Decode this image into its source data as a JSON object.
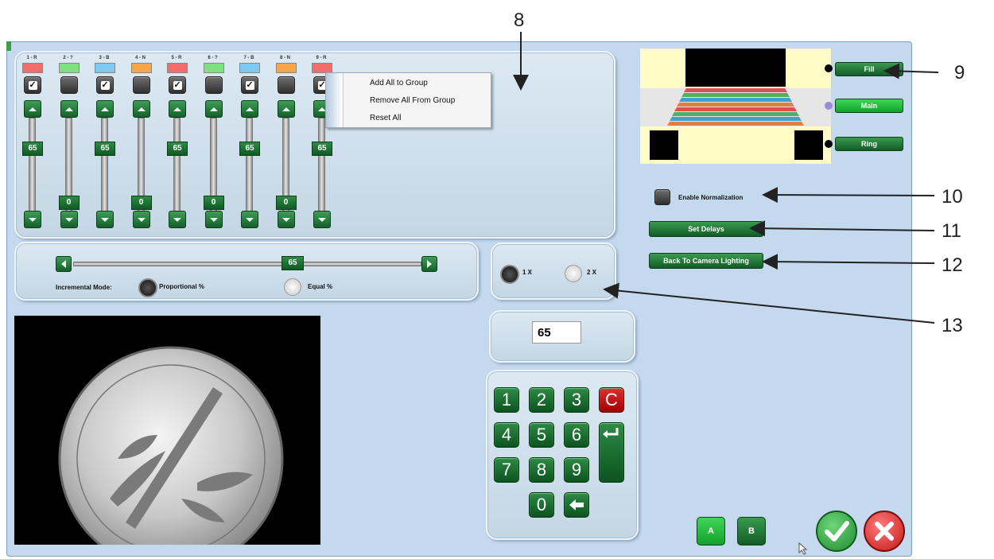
{
  "channels": [
    {
      "label": "1 - R",
      "color": "#f26d6d",
      "checked": true,
      "value": "65"
    },
    {
      "label": "2 - ?",
      "color": "#7fe07f",
      "checked": false,
      "value": "0"
    },
    {
      "label": "3 - B",
      "color": "#7fc9f0",
      "checked": true,
      "value": "65"
    },
    {
      "label": "4 - N",
      "color": "#f5a64a",
      "checked": false,
      "value": "0"
    },
    {
      "label": "5 - R",
      "color": "#f26d6d",
      "checked": true,
      "value": "65"
    },
    {
      "label": "6 - ?",
      "color": "#7fe07f",
      "checked": false,
      "value": "0"
    },
    {
      "label": "7 - B",
      "color": "#7fc9f0",
      "checked": true,
      "value": "65"
    },
    {
      "label": "8 - N",
      "color": "#f5a64a",
      "checked": false,
      "value": "0"
    },
    {
      "label": "9 - R",
      "color": "#f26d6d",
      "checked": true,
      "value": "65"
    }
  ],
  "context_menu": {
    "items": [
      "Add All to Group",
      "Remove All From Group",
      "Reset All"
    ]
  },
  "master_slider": {
    "value": "65",
    "mode_label": "Incremental Mode:",
    "proportional_label": "Proportional %",
    "equal_label": "Equal %",
    "selected_mode": "proportional"
  },
  "zoom": {
    "option_1x": "1 X",
    "option_2x": "2 X",
    "selected": "1x"
  },
  "value_input": {
    "value": "65"
  },
  "keypad": {
    "keys": [
      "1",
      "2",
      "3",
      "C",
      "4",
      "5",
      "6",
      "7",
      "8",
      "9",
      "0"
    ],
    "enter_icon": "enter-icon",
    "backspace_icon": "backspace-icon"
  },
  "lighting": {
    "fill_label": "Fill",
    "main_label": "Main",
    "ring_label": "Ring",
    "active": "main",
    "stripe_colors": [
      "#e05050",
      "#50b060",
      "#40a0d0",
      "#e08040",
      "#e05050",
      "#50b060",
      "#40a0d0",
      "#e08040"
    ]
  },
  "options": {
    "normalization_label": "Enable Normalization",
    "set_delays_label": "Set Delays",
    "back_label": "Back To Camera Lighting"
  },
  "groups": {
    "a_label": "A",
    "b_label": "B"
  },
  "annotations": {
    "n8": "8",
    "n9": "9",
    "n10": "10",
    "n11": "11",
    "n12": "12",
    "n13": "13"
  },
  "colors": {
    "accent": "#1b7a35",
    "window_bg": "#c5d9ee",
    "ok": "#2e9e3f",
    "cancel": "#d62828"
  }
}
